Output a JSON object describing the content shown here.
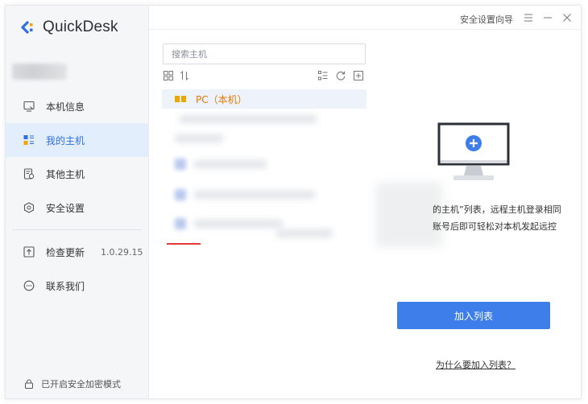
{
  "app": {
    "name": "QuickDesk"
  },
  "titlebar": {
    "wizard_label": "安全设置向导",
    "menu_icon": "menu-icon",
    "minimize_icon": "minimize-icon",
    "close_icon": "close-icon"
  },
  "sidebar": {
    "items": [
      {
        "label": "本机信息",
        "icon": "monitor-info-icon"
      },
      {
        "label": "我的主机",
        "icon": "host-list-icon",
        "active": true
      },
      {
        "label": "其他主机",
        "icon": "other-hosts-icon"
      },
      {
        "label": "安全设置",
        "icon": "shield-icon"
      },
      {
        "label": "检查更新",
        "icon": "update-icon",
        "version": "1.0.29.15"
      },
      {
        "label": "联系我们",
        "icon": "chat-icon"
      }
    ],
    "footer": {
      "label": "已开启安全加密模式",
      "icon": "lock-icon"
    }
  },
  "hosts": {
    "search_placeholder": "搜索主机",
    "local_host": "PC（本机）"
  },
  "right_panel": {
    "desc_line1": "的主机”列表，远程主机登录相同",
    "desc_line2": "账号后即可轻松对本机发起远控",
    "add_button": "加入列表",
    "why_link": "为什么要加入列表？"
  },
  "colors": {
    "accent": "#3d7eeb",
    "active_bg": "#e3eefd",
    "local_host": "#e07a00"
  }
}
